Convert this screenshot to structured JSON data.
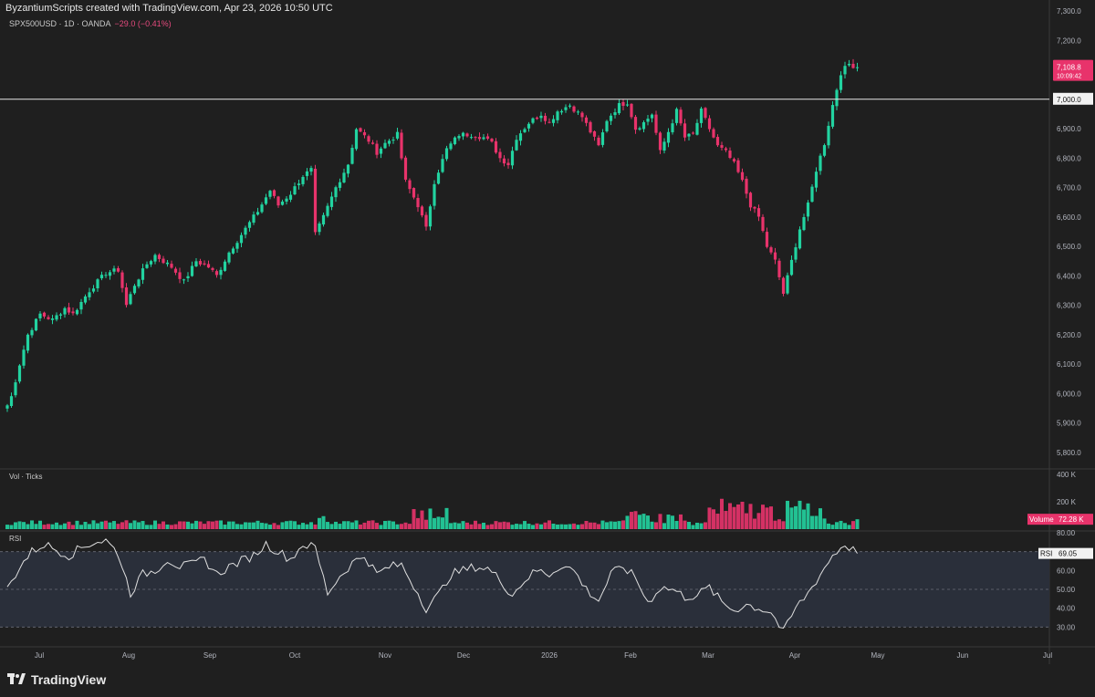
{
  "header": {
    "attribution": "ByzantiumScripts created with TradingView.com, Apr 23, 2026 10:50 UTC"
  },
  "legend": {
    "symbol": "SPX500USD · 1D · OANDA",
    "change": "−29.0 (−0.41%)"
  },
  "brand": {
    "name": "TradingView"
  },
  "colors": {
    "up": "#22d3a0",
    "down": "#e8336b",
    "background": "#1f1f1f",
    "rsi_band": "#2a2f3a",
    "line": "#e0e0e0"
  },
  "chart_data": [
    {
      "type": "candlestick",
      "title": "",
      "ylabel": "",
      "ylim": [
        5750,
        7300
      ],
      "yticks": [
        "7,300.0",
        "7,200.0",
        "7,100.0",
        "7,000.0",
        "6,900.0",
        "6,800.0",
        "6,700.0",
        "6,600.0",
        "6,500.0",
        "6,400.0",
        "6,300.0",
        "6,200.0",
        "6,100.0",
        "6,000.0",
        "5,900.0",
        "5,800.0"
      ],
      "xticks": [
        "Jul",
        "Aug",
        "Sep",
        "Oct",
        "Nov",
        "Dec",
        "2026",
        "Feb",
        "Mar",
        "Apr",
        "May",
        "Jun",
        "Jul"
      ],
      "horizontal_line": {
        "value": 7000,
        "label": "7,000.0"
      },
      "last_price": {
        "value": 7108.8,
        "label": "7,108.8",
        "countdown": "10:09:42"
      },
      "close_path": [
        [
          0,
          5960
        ],
        [
          1,
          5990
        ],
        [
          3,
          6100
        ],
        [
          5,
          6200
        ],
        [
          8,
          6270
        ],
        [
          11,
          6250
        ],
        [
          14,
          6290
        ],
        [
          16,
          6270
        ],
        [
          20,
          6350
        ],
        [
          24,
          6410
        ],
        [
          27,
          6420
        ],
        [
          29,
          6300
        ],
        [
          31,
          6370
        ],
        [
          34,
          6440
        ],
        [
          36,
          6470
        ],
        [
          40,
          6430
        ],
        [
          43,
          6380
        ],
        [
          46,
          6450
        ],
        [
          49,
          6430
        ],
        [
          51,
          6400
        ],
        [
          54,
          6480
        ],
        [
          58,
          6560
        ],
        [
          61,
          6620
        ],
        [
          64,
          6690
        ],
        [
          66,
          6640
        ],
        [
          69,
          6680
        ],
        [
          72,
          6740
        ],
        [
          74,
          6760
        ],
        [
          75,
          6540
        ],
        [
          77,
          6600
        ],
        [
          80,
          6700
        ],
        [
          83,
          6780
        ],
        [
          85,
          6900
        ],
        [
          88,
          6860
        ],
        [
          90,
          6820
        ],
        [
          92,
          6850
        ],
        [
          95,
          6880
        ],
        [
          97,
          6720
        ],
        [
          100,
          6640
        ],
        [
          102,
          6560
        ],
        [
          104,
          6720
        ],
        [
          107,
          6830
        ],
        [
          110,
          6880
        ],
        [
          113,
          6880
        ],
        [
          116,
          6870
        ],
        [
          118,
          6850
        ],
        [
          120,
          6800
        ],
        [
          122,
          6780
        ],
        [
          124,
          6870
        ],
        [
          127,
          6920
        ],
        [
          130,
          6950
        ],
        [
          132,
          6920
        ],
        [
          134,
          6960
        ],
        [
          137,
          6980
        ],
        [
          140,
          6940
        ],
        [
          142,
          6890
        ],
        [
          144,
          6840
        ],
        [
          146,
          6930
        ],
        [
          149,
          6980
        ],
        [
          151,
          6990
        ],
        [
          153,
          6900
        ],
        [
          155,
          6920
        ],
        [
          157,
          6950
        ],
        [
          159,
          6820
        ],
        [
          161,
          6890
        ],
        [
          163,
          6960
        ],
        [
          165,
          6870
        ],
        [
          167,
          6880
        ],
        [
          169,
          6960
        ],
        [
          171,
          6900
        ],
        [
          173,
          6840
        ],
        [
          175,
          6820
        ],
        [
          177,
          6780
        ],
        [
          179,
          6720
        ],
        [
          181,
          6640
        ],
        [
          183,
          6600
        ],
        [
          185,
          6500
        ],
        [
          187,
          6450
        ],
        [
          189,
          6340
        ],
        [
          191,
          6450
        ],
        [
          193,
          6560
        ],
        [
          195,
          6640
        ],
        [
          197,
          6760
        ],
        [
          199,
          6850
        ],
        [
          201,
          6980
        ],
        [
          203,
          7090
        ],
        [
          205,
          7120
        ],
        [
          207,
          7108.8
        ]
      ]
    },
    {
      "type": "bar",
      "title": "Vol · Ticks",
      "yticks": [
        "400 K",
        "200 K"
      ],
      "ylim": [
        0,
        400000
      ],
      "last_value": {
        "label": "Volume",
        "value": "72.28 K"
      }
    },
    {
      "type": "line",
      "title": "RSI",
      "ylim": [
        20,
        80
      ],
      "yticks": [
        "80.00",
        "70.00",
        "60.00",
        "50.00",
        "40.00",
        "30.00"
      ],
      "band": [
        30,
        70
      ],
      "midline": 50,
      "last_value": {
        "label": "RSI",
        "value": "69.05"
      },
      "values_path": [
        [
          0,
          50
        ],
        [
          3,
          62
        ],
        [
          6,
          70
        ],
        [
          9,
          74
        ],
        [
          12,
          71
        ],
        [
          15,
          68
        ],
        [
          18,
          72
        ],
        [
          21,
          75
        ],
        [
          24,
          76
        ],
        [
          27,
          69
        ],
        [
          30,
          48
        ],
        [
          33,
          58
        ],
        [
          36,
          60
        ],
        [
          39,
          66
        ],
        [
          42,
          62
        ],
        [
          45,
          63
        ],
        [
          48,
          66
        ],
        [
          51,
          58
        ],
        [
          54,
          62
        ],
        [
          57,
          65
        ],
        [
          60,
          68
        ],
        [
          63,
          74
        ],
        [
          66,
          70
        ],
        [
          69,
          66
        ],
        [
          72,
          74
        ],
        [
          75,
          72
        ],
        [
          78,
          48
        ],
        [
          81,
          57
        ],
        [
          84,
          64
        ],
        [
          87,
          68
        ],
        [
          90,
          58
        ],
        [
          93,
          62
        ],
        [
          96,
          63
        ],
        [
          99,
          52
        ],
        [
          102,
          40
        ],
        [
          105,
          47
        ],
        [
          108,
          58
        ],
        [
          111,
          60
        ],
        [
          114,
          62
        ],
        [
          117,
          61
        ],
        [
          120,
          55
        ],
        [
          123,
          47
        ],
        [
          126,
          55
        ],
        [
          129,
          60
        ],
        [
          132,
          58
        ],
        [
          135,
          63
        ],
        [
          138,
          60
        ],
        [
          141,
          50
        ],
        [
          144,
          44
        ],
        [
          147,
          58
        ],
        [
          150,
          62
        ],
        [
          153,
          56
        ],
        [
          156,
          43
        ],
        [
          159,
          51
        ],
        [
          162,
          50
        ],
        [
          165,
          46
        ],
        [
          168,
          47
        ],
        [
          171,
          51
        ],
        [
          174,
          43
        ],
        [
          177,
          39
        ],
        [
          180,
          42
        ],
        [
          183,
          40
        ],
        [
          186,
          38
        ],
        [
          189,
          27
        ],
        [
          192,
          40
        ],
        [
          195,
          48
        ],
        [
          198,
          58
        ],
        [
          201,
          68
        ],
        [
          204,
          74
        ],
        [
          207,
          69.05
        ]
      ]
    }
  ]
}
